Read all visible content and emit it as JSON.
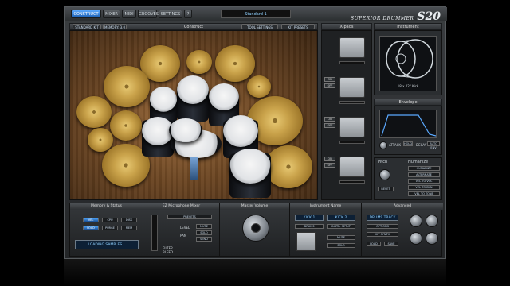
{
  "topbar": {
    "tabs": [
      "CONSTRUCT",
      "MIXER",
      "MIDI",
      "GROOVES",
      "SETTINGS",
      "?"
    ],
    "active_tab": 0,
    "preset_name": "Standard 1",
    "brand_small": "SUPERIOR DRUMMER",
    "brand_large": "S20"
  },
  "construct": {
    "title": "Construct",
    "left_buttons": [
      "STANDARD KIT",
      "MEMORY: 3.0"
    ],
    "right_buttons": [
      "TOOL SETTINGS",
      "KIT PRESETS"
    ]
  },
  "pads": {
    "title": "X-pads",
    "buttons": [
      "ON",
      "OFF"
    ]
  },
  "instrument": {
    "title": "Instrument",
    "caption": "18 x 22\" Kick"
  },
  "envelope": {
    "title": "Envelope",
    "labels": [
      "ATTACK",
      "HOLD",
      "DECAY",
      "AUTO ENV"
    ]
  },
  "pitch": {
    "title": "Pitch",
    "reset_label": "RESET"
  },
  "humanize": {
    "title": "Humanize",
    "items": [
      "HUMANIZE",
      "ALTERNATE",
      "VEL TO VOL",
      "VEL TO DYN",
      "VEL TO TONE"
    ]
  },
  "bottom": {
    "sections": {
      "memory": "Memory & Status",
      "mic": "EZ Microphone Mixer",
      "master": "Master Volume",
      "inst_name": "Instrument Name",
      "advanced": "Advanced"
    },
    "memory_buttons": [
      "VEL",
      "CPU",
      "DISK",
      "LOAD",
      "PURGE",
      "MEM"
    ],
    "status_text": "LOADING SAMPLES...",
    "mic_presets": [
      "PRESETS"
    ],
    "mic_labels": [
      "FILTER",
      "BLEED",
      "LEVEL",
      "PAN",
      "MUTE",
      "SOLO",
      "SEND"
    ],
    "inst_controls": [
      "KICK 1",
      "KICK 2",
      "DRUMS",
      "INSTR. SETUP",
      "MUTE",
      "SOLO"
    ],
    "advanced_controls": [
      "DRUMS TRACK",
      "OPTIONS",
      "HIT SYNTH",
      "LOAD",
      "SAVE"
    ]
  }
}
